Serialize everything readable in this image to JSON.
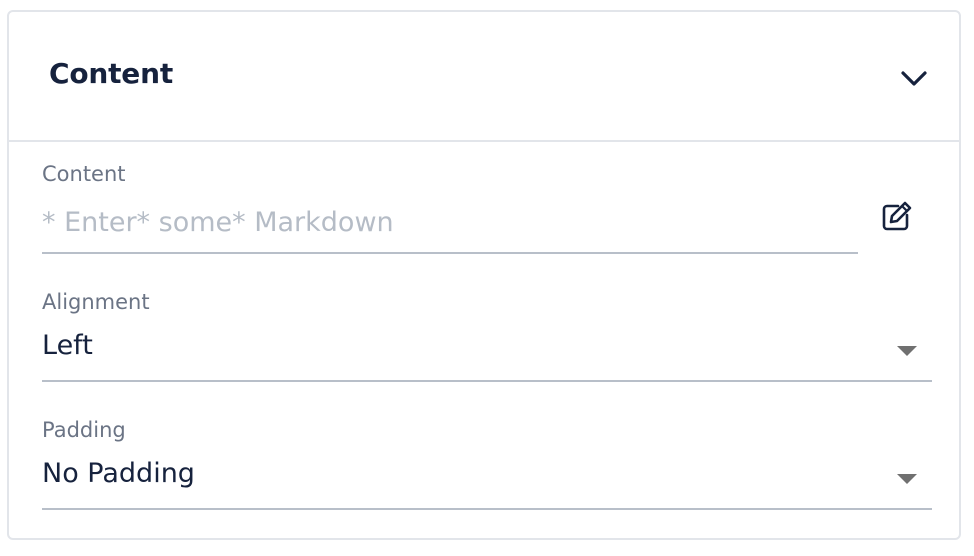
{
  "panel": {
    "title": "Content",
    "collapse_icon": "chevron-down-icon"
  },
  "fields": {
    "content": {
      "label": "Content",
      "value": "",
      "placeholder": "* Enter* some* Markdown",
      "action_icon": "edit-icon"
    },
    "alignment": {
      "label": "Alignment",
      "selected": "Left",
      "icon": "caret-down-icon"
    },
    "padding": {
      "label": "Padding",
      "selected": "No Padding",
      "icon": "caret-down-icon"
    }
  },
  "colors": {
    "title_text": "#16223d",
    "label_text": "#6b7485",
    "placeholder_text": "#b5bcc6",
    "border": "#e2e5ea",
    "underline": "#b8bfc9",
    "caret": "#707070"
  }
}
